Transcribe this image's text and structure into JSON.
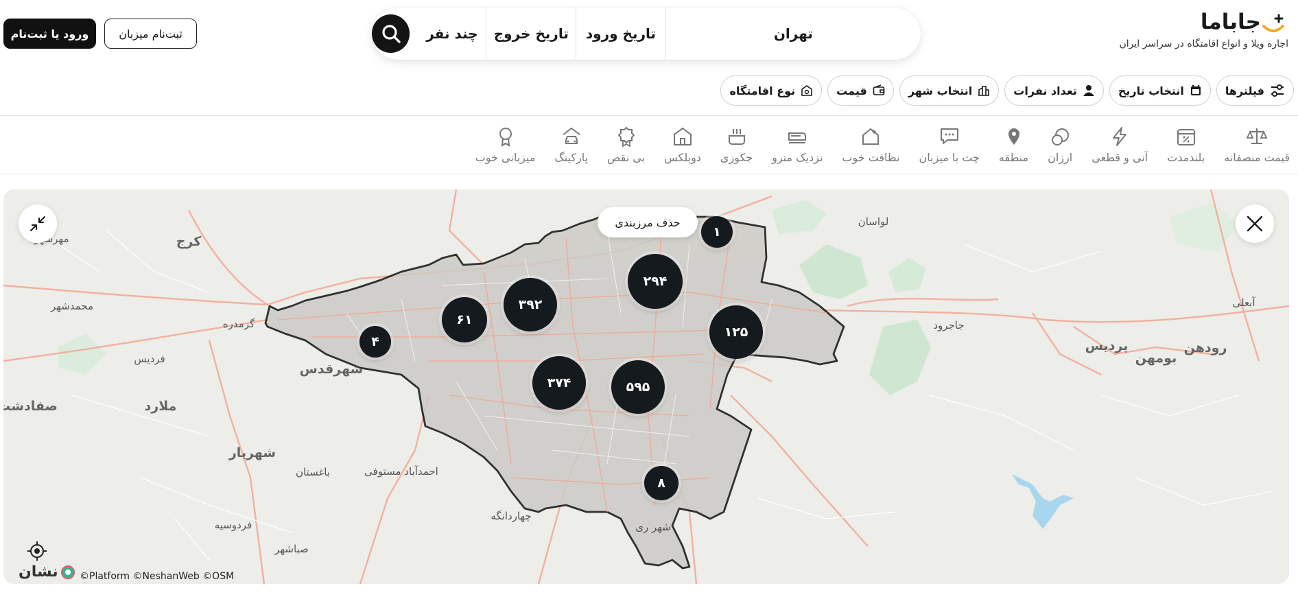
{
  "header": {
    "logo_text": "جاباما",
    "tagline": "اجاره ویلا و انواع اقامتگاه در سراسر ایران",
    "brand_color": "#f5a623",
    "search": {
      "city": "تهران",
      "check_in": "تاریخ ورود",
      "check_out": "تاریخ خروج",
      "guests": "چند نفر",
      "search_icon": "search-icon"
    },
    "login_label": "ورود یا ثبت‌نام",
    "host_signup_label": "ثبت‌نام میزبان"
  },
  "filters": [
    {
      "label": "فیلترها",
      "icon": "sliders-icon"
    },
    {
      "label": "انتخاب تاریخ",
      "icon": "calendar-icon"
    },
    {
      "label": "تعداد نفرات",
      "icon": "person-icon"
    },
    {
      "label": "انتخاب شهر",
      "icon": "city-icon"
    },
    {
      "label": "قیمت",
      "icon": "wallet-icon"
    },
    {
      "label": "نوع اقامتگاه",
      "icon": "house-icon"
    }
  ],
  "categories": [
    {
      "label": "قیمت منصفانه",
      "icon": "scale-icon"
    },
    {
      "label": "بلندمدت",
      "icon": "calendar-percent-icon"
    },
    {
      "label": "آنی و قطعی",
      "icon": "lightning-icon"
    },
    {
      "label": "ارزان",
      "icon": "coin-icon"
    },
    {
      "label": "منطقه",
      "icon": "location-pin-icon"
    },
    {
      "label": "چت با میزبان",
      "icon": "chat-icon"
    },
    {
      "label": "نظافت خوب",
      "icon": "clean-house-icon"
    },
    {
      "label": "نزدیک مترو",
      "icon": "metro-icon"
    },
    {
      "label": "جکوزی",
      "icon": "jacuzzi-icon"
    },
    {
      "label": "دوبلکس",
      "icon": "duplex-icon"
    },
    {
      "label": "بی نقص",
      "icon": "badge-icon"
    },
    {
      "label": "پارکینگ",
      "icon": "parking-icon"
    },
    {
      "label": "میزبانی خوب",
      "icon": "host-icon"
    }
  ],
  "map": {
    "remove_border_label": "حذف مرزبندی",
    "credit": "©Platform ©NeshanWeb ©OSM",
    "provider_name": "نشان",
    "clusters": [
      "۱",
      "۲۹۴",
      "۳۹۲",
      "۶۱",
      "۴",
      "۱۲۵",
      "۳۷۴",
      "۵۹۵",
      "۸"
    ],
    "places": {
      "mehrshahr": "مهرشهر",
      "karaj": "کرج",
      "mohammadshahr": "محمدشهر",
      "garmdareh": "گرمدره",
      "fardis": "فردیس",
      "shahrqods": "شهرقدس",
      "malard": "ملارد",
      "sadatshahr": "صفادشت",
      "shahriar": "شهریار",
      "baghestan": "باغستان",
      "ahmadabad": "احمدآباد مستوفی",
      "chahardangeh": "چهاردانگه",
      "ferdowsieh": "فردوسیه",
      "sabashahr": "صباشهر",
      "shahrerey": "شهر ری",
      "lavasan": "لواسان",
      "jajrood": "جاجرود",
      "pardis": "پردیس",
      "boomehen": "بومهن",
      "roodehen": "رودهن",
      "abali": "آبعلی"
    }
  }
}
